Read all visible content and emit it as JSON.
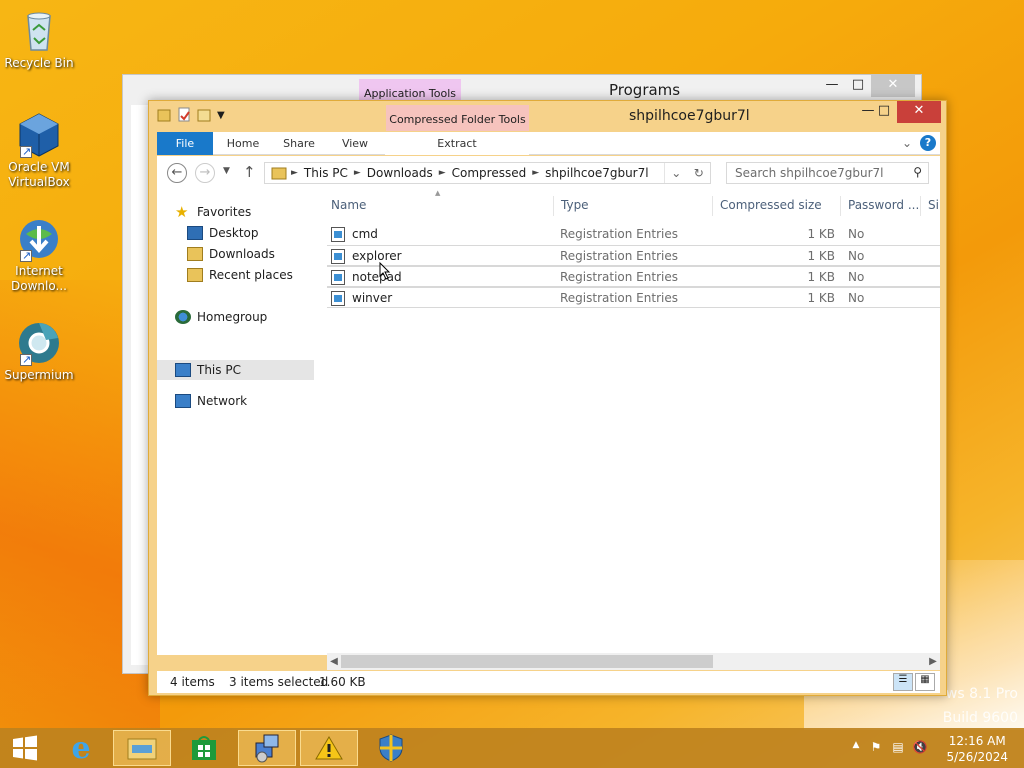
{
  "desktop": {
    "icons": [
      {
        "label": "Recycle Bin"
      },
      {
        "label": "Oracle VM VirtualBox"
      },
      {
        "label": "Internet Downlo..."
      },
      {
        "label": "Supermium"
      }
    ],
    "watermark_line1": "ws 8.1 Pro",
    "watermark_line2": "Build 9600"
  },
  "back_window": {
    "title": "Programs",
    "context_tab": "Application Tools"
  },
  "window": {
    "title": "shpilhcoe7gbur7l",
    "context_tab": "Compressed Folder Tools",
    "ribbon_tabs": [
      "File",
      "Home",
      "Share",
      "View",
      "Extract"
    ],
    "breadcrumb": [
      "This PC",
      "Downloads",
      "Compressed",
      "shpilhcoe7gbur7l"
    ],
    "search_placeholder": "Search shpilhcoe7gbur7l",
    "nav": {
      "favorites": "Favorites",
      "desktop": "Desktop",
      "downloads": "Downloads",
      "recent": "Recent places",
      "homegroup": "Homegroup",
      "thispc": "This PC",
      "network": "Network"
    },
    "columns": [
      "Name",
      "Type",
      "Compressed size",
      "Password ...",
      "Si"
    ],
    "files": [
      {
        "name": "cmd",
        "type": "Registration Entries",
        "size": "1 KB",
        "password": "No"
      },
      {
        "name": "explorer",
        "type": "Registration Entries",
        "size": "1 KB",
        "password": "No"
      },
      {
        "name": "notepad",
        "type": "Registration Entries",
        "size": "1 KB",
        "password": "No"
      },
      {
        "name": "winver",
        "type": "Registration Entries",
        "size": "1 KB",
        "password": "No"
      }
    ],
    "status": {
      "items": "4 items",
      "selected": "3 items selected",
      "size": "1.60 KB"
    }
  },
  "taskbar": {
    "time": "12:16 AM",
    "date": "5/26/2024"
  },
  "colors": {
    "accent": "#1979ca",
    "close": "#c9403a",
    "window_frame": "#f6d28a"
  }
}
